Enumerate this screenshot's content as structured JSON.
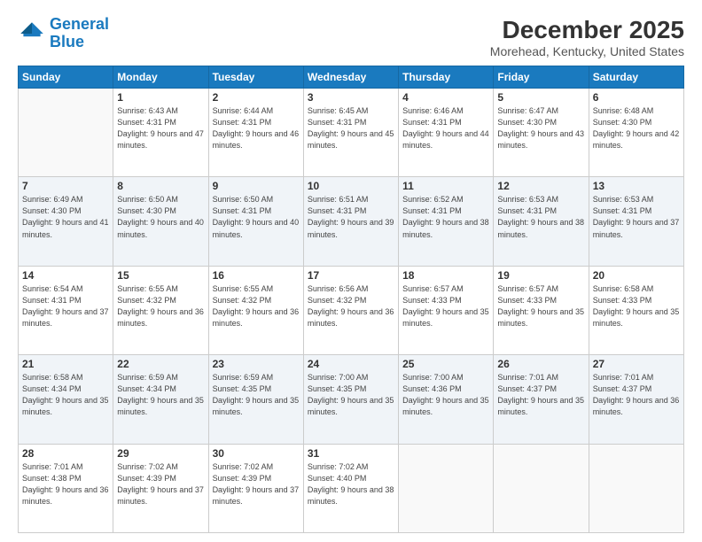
{
  "logo": {
    "line1": "General",
    "line2": "Blue"
  },
  "title": "December 2025",
  "subtitle": "Morehead, Kentucky, United States",
  "days_of_week": [
    "Sunday",
    "Monday",
    "Tuesday",
    "Wednesday",
    "Thursday",
    "Friday",
    "Saturday"
  ],
  "weeks": [
    [
      {
        "day": "",
        "sunrise": "",
        "sunset": "",
        "daylight": ""
      },
      {
        "day": "1",
        "sunrise": "Sunrise: 6:43 AM",
        "sunset": "Sunset: 4:31 PM",
        "daylight": "Daylight: 9 hours and 47 minutes."
      },
      {
        "day": "2",
        "sunrise": "Sunrise: 6:44 AM",
        "sunset": "Sunset: 4:31 PM",
        "daylight": "Daylight: 9 hours and 46 minutes."
      },
      {
        "day": "3",
        "sunrise": "Sunrise: 6:45 AM",
        "sunset": "Sunset: 4:31 PM",
        "daylight": "Daylight: 9 hours and 45 minutes."
      },
      {
        "day": "4",
        "sunrise": "Sunrise: 6:46 AM",
        "sunset": "Sunset: 4:31 PM",
        "daylight": "Daylight: 9 hours and 44 minutes."
      },
      {
        "day": "5",
        "sunrise": "Sunrise: 6:47 AM",
        "sunset": "Sunset: 4:30 PM",
        "daylight": "Daylight: 9 hours and 43 minutes."
      },
      {
        "day": "6",
        "sunrise": "Sunrise: 6:48 AM",
        "sunset": "Sunset: 4:30 PM",
        "daylight": "Daylight: 9 hours and 42 minutes."
      }
    ],
    [
      {
        "day": "7",
        "sunrise": "Sunrise: 6:49 AM",
        "sunset": "Sunset: 4:30 PM",
        "daylight": "Daylight: 9 hours and 41 minutes."
      },
      {
        "day": "8",
        "sunrise": "Sunrise: 6:50 AM",
        "sunset": "Sunset: 4:30 PM",
        "daylight": "Daylight: 9 hours and 40 minutes."
      },
      {
        "day": "9",
        "sunrise": "Sunrise: 6:50 AM",
        "sunset": "Sunset: 4:31 PM",
        "daylight": "Daylight: 9 hours and 40 minutes."
      },
      {
        "day": "10",
        "sunrise": "Sunrise: 6:51 AM",
        "sunset": "Sunset: 4:31 PM",
        "daylight": "Daylight: 9 hours and 39 minutes."
      },
      {
        "day": "11",
        "sunrise": "Sunrise: 6:52 AM",
        "sunset": "Sunset: 4:31 PM",
        "daylight": "Daylight: 9 hours and 38 minutes."
      },
      {
        "day": "12",
        "sunrise": "Sunrise: 6:53 AM",
        "sunset": "Sunset: 4:31 PM",
        "daylight": "Daylight: 9 hours and 38 minutes."
      },
      {
        "day": "13",
        "sunrise": "Sunrise: 6:53 AM",
        "sunset": "Sunset: 4:31 PM",
        "daylight": "Daylight: 9 hours and 37 minutes."
      }
    ],
    [
      {
        "day": "14",
        "sunrise": "Sunrise: 6:54 AM",
        "sunset": "Sunset: 4:31 PM",
        "daylight": "Daylight: 9 hours and 37 minutes."
      },
      {
        "day": "15",
        "sunrise": "Sunrise: 6:55 AM",
        "sunset": "Sunset: 4:32 PM",
        "daylight": "Daylight: 9 hours and 36 minutes."
      },
      {
        "day": "16",
        "sunrise": "Sunrise: 6:55 AM",
        "sunset": "Sunset: 4:32 PM",
        "daylight": "Daylight: 9 hours and 36 minutes."
      },
      {
        "day": "17",
        "sunrise": "Sunrise: 6:56 AM",
        "sunset": "Sunset: 4:32 PM",
        "daylight": "Daylight: 9 hours and 36 minutes."
      },
      {
        "day": "18",
        "sunrise": "Sunrise: 6:57 AM",
        "sunset": "Sunset: 4:33 PM",
        "daylight": "Daylight: 9 hours and 35 minutes."
      },
      {
        "day": "19",
        "sunrise": "Sunrise: 6:57 AM",
        "sunset": "Sunset: 4:33 PM",
        "daylight": "Daylight: 9 hours and 35 minutes."
      },
      {
        "day": "20",
        "sunrise": "Sunrise: 6:58 AM",
        "sunset": "Sunset: 4:33 PM",
        "daylight": "Daylight: 9 hours and 35 minutes."
      }
    ],
    [
      {
        "day": "21",
        "sunrise": "Sunrise: 6:58 AM",
        "sunset": "Sunset: 4:34 PM",
        "daylight": "Daylight: 9 hours and 35 minutes."
      },
      {
        "day": "22",
        "sunrise": "Sunrise: 6:59 AM",
        "sunset": "Sunset: 4:34 PM",
        "daylight": "Daylight: 9 hours and 35 minutes."
      },
      {
        "day": "23",
        "sunrise": "Sunrise: 6:59 AM",
        "sunset": "Sunset: 4:35 PM",
        "daylight": "Daylight: 9 hours and 35 minutes."
      },
      {
        "day": "24",
        "sunrise": "Sunrise: 7:00 AM",
        "sunset": "Sunset: 4:35 PM",
        "daylight": "Daylight: 9 hours and 35 minutes."
      },
      {
        "day": "25",
        "sunrise": "Sunrise: 7:00 AM",
        "sunset": "Sunset: 4:36 PM",
        "daylight": "Daylight: 9 hours and 35 minutes."
      },
      {
        "day": "26",
        "sunrise": "Sunrise: 7:01 AM",
        "sunset": "Sunset: 4:37 PM",
        "daylight": "Daylight: 9 hours and 35 minutes."
      },
      {
        "day": "27",
        "sunrise": "Sunrise: 7:01 AM",
        "sunset": "Sunset: 4:37 PM",
        "daylight": "Daylight: 9 hours and 36 minutes."
      }
    ],
    [
      {
        "day": "28",
        "sunrise": "Sunrise: 7:01 AM",
        "sunset": "Sunset: 4:38 PM",
        "daylight": "Daylight: 9 hours and 36 minutes."
      },
      {
        "day": "29",
        "sunrise": "Sunrise: 7:02 AM",
        "sunset": "Sunset: 4:39 PM",
        "daylight": "Daylight: 9 hours and 37 minutes."
      },
      {
        "day": "30",
        "sunrise": "Sunrise: 7:02 AM",
        "sunset": "Sunset: 4:39 PM",
        "daylight": "Daylight: 9 hours and 37 minutes."
      },
      {
        "day": "31",
        "sunrise": "Sunrise: 7:02 AM",
        "sunset": "Sunset: 4:40 PM",
        "daylight": "Daylight: 9 hours and 38 minutes."
      },
      {
        "day": "",
        "sunrise": "",
        "sunset": "",
        "daylight": ""
      },
      {
        "day": "",
        "sunrise": "",
        "sunset": "",
        "daylight": ""
      },
      {
        "day": "",
        "sunrise": "",
        "sunset": "",
        "daylight": ""
      }
    ]
  ]
}
